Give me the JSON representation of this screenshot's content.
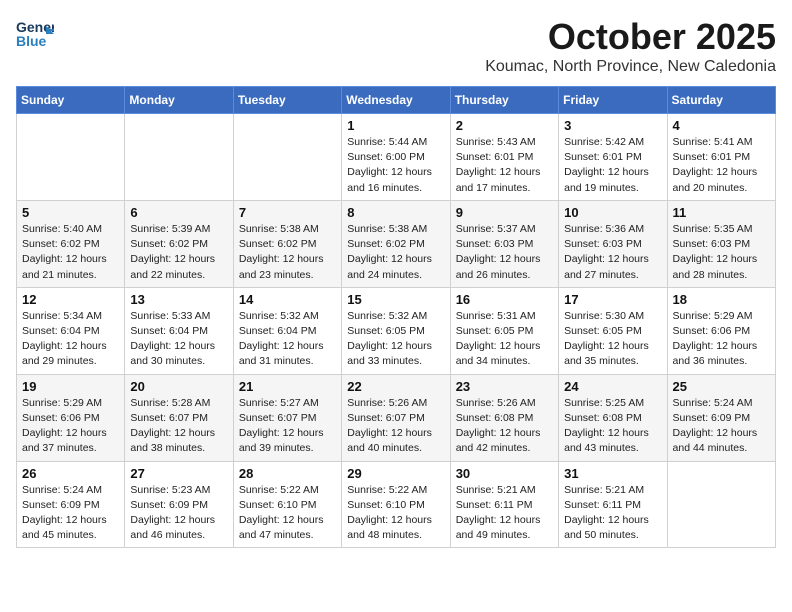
{
  "header": {
    "logo_general": "General",
    "logo_blue": "Blue",
    "month_title": "October 2025",
    "location": "Koumac, North Province, New Caledonia"
  },
  "weekdays": [
    "Sunday",
    "Monday",
    "Tuesday",
    "Wednesday",
    "Thursday",
    "Friday",
    "Saturday"
  ],
  "weeks": [
    [
      {
        "day": "",
        "info": ""
      },
      {
        "day": "",
        "info": ""
      },
      {
        "day": "",
        "info": ""
      },
      {
        "day": "1",
        "info": "Sunrise: 5:44 AM\nSunset: 6:00 PM\nDaylight: 12 hours\nand 16 minutes."
      },
      {
        "day": "2",
        "info": "Sunrise: 5:43 AM\nSunset: 6:01 PM\nDaylight: 12 hours\nand 17 minutes."
      },
      {
        "day": "3",
        "info": "Sunrise: 5:42 AM\nSunset: 6:01 PM\nDaylight: 12 hours\nand 19 minutes."
      },
      {
        "day": "4",
        "info": "Sunrise: 5:41 AM\nSunset: 6:01 PM\nDaylight: 12 hours\nand 20 minutes."
      }
    ],
    [
      {
        "day": "5",
        "info": "Sunrise: 5:40 AM\nSunset: 6:02 PM\nDaylight: 12 hours\nand 21 minutes."
      },
      {
        "day": "6",
        "info": "Sunrise: 5:39 AM\nSunset: 6:02 PM\nDaylight: 12 hours\nand 22 minutes."
      },
      {
        "day": "7",
        "info": "Sunrise: 5:38 AM\nSunset: 6:02 PM\nDaylight: 12 hours\nand 23 minutes."
      },
      {
        "day": "8",
        "info": "Sunrise: 5:38 AM\nSunset: 6:02 PM\nDaylight: 12 hours\nand 24 minutes."
      },
      {
        "day": "9",
        "info": "Sunrise: 5:37 AM\nSunset: 6:03 PM\nDaylight: 12 hours\nand 26 minutes."
      },
      {
        "day": "10",
        "info": "Sunrise: 5:36 AM\nSunset: 6:03 PM\nDaylight: 12 hours\nand 27 minutes."
      },
      {
        "day": "11",
        "info": "Sunrise: 5:35 AM\nSunset: 6:03 PM\nDaylight: 12 hours\nand 28 minutes."
      }
    ],
    [
      {
        "day": "12",
        "info": "Sunrise: 5:34 AM\nSunset: 6:04 PM\nDaylight: 12 hours\nand 29 minutes."
      },
      {
        "day": "13",
        "info": "Sunrise: 5:33 AM\nSunset: 6:04 PM\nDaylight: 12 hours\nand 30 minutes."
      },
      {
        "day": "14",
        "info": "Sunrise: 5:32 AM\nSunset: 6:04 PM\nDaylight: 12 hours\nand 31 minutes."
      },
      {
        "day": "15",
        "info": "Sunrise: 5:32 AM\nSunset: 6:05 PM\nDaylight: 12 hours\nand 33 minutes."
      },
      {
        "day": "16",
        "info": "Sunrise: 5:31 AM\nSunset: 6:05 PM\nDaylight: 12 hours\nand 34 minutes."
      },
      {
        "day": "17",
        "info": "Sunrise: 5:30 AM\nSunset: 6:05 PM\nDaylight: 12 hours\nand 35 minutes."
      },
      {
        "day": "18",
        "info": "Sunrise: 5:29 AM\nSunset: 6:06 PM\nDaylight: 12 hours\nand 36 minutes."
      }
    ],
    [
      {
        "day": "19",
        "info": "Sunrise: 5:29 AM\nSunset: 6:06 PM\nDaylight: 12 hours\nand 37 minutes."
      },
      {
        "day": "20",
        "info": "Sunrise: 5:28 AM\nSunset: 6:07 PM\nDaylight: 12 hours\nand 38 minutes."
      },
      {
        "day": "21",
        "info": "Sunrise: 5:27 AM\nSunset: 6:07 PM\nDaylight: 12 hours\nand 39 minutes."
      },
      {
        "day": "22",
        "info": "Sunrise: 5:26 AM\nSunset: 6:07 PM\nDaylight: 12 hours\nand 40 minutes."
      },
      {
        "day": "23",
        "info": "Sunrise: 5:26 AM\nSunset: 6:08 PM\nDaylight: 12 hours\nand 42 minutes."
      },
      {
        "day": "24",
        "info": "Sunrise: 5:25 AM\nSunset: 6:08 PM\nDaylight: 12 hours\nand 43 minutes."
      },
      {
        "day": "25",
        "info": "Sunrise: 5:24 AM\nSunset: 6:09 PM\nDaylight: 12 hours\nand 44 minutes."
      }
    ],
    [
      {
        "day": "26",
        "info": "Sunrise: 5:24 AM\nSunset: 6:09 PM\nDaylight: 12 hours\nand 45 minutes."
      },
      {
        "day": "27",
        "info": "Sunrise: 5:23 AM\nSunset: 6:09 PM\nDaylight: 12 hours\nand 46 minutes."
      },
      {
        "day": "28",
        "info": "Sunrise: 5:22 AM\nSunset: 6:10 PM\nDaylight: 12 hours\nand 47 minutes."
      },
      {
        "day": "29",
        "info": "Sunrise: 5:22 AM\nSunset: 6:10 PM\nDaylight: 12 hours\nand 48 minutes."
      },
      {
        "day": "30",
        "info": "Sunrise: 5:21 AM\nSunset: 6:11 PM\nDaylight: 12 hours\nand 49 minutes."
      },
      {
        "day": "31",
        "info": "Sunrise: 5:21 AM\nSunset: 6:11 PM\nDaylight: 12 hours\nand 50 minutes."
      },
      {
        "day": "",
        "info": ""
      }
    ]
  ]
}
